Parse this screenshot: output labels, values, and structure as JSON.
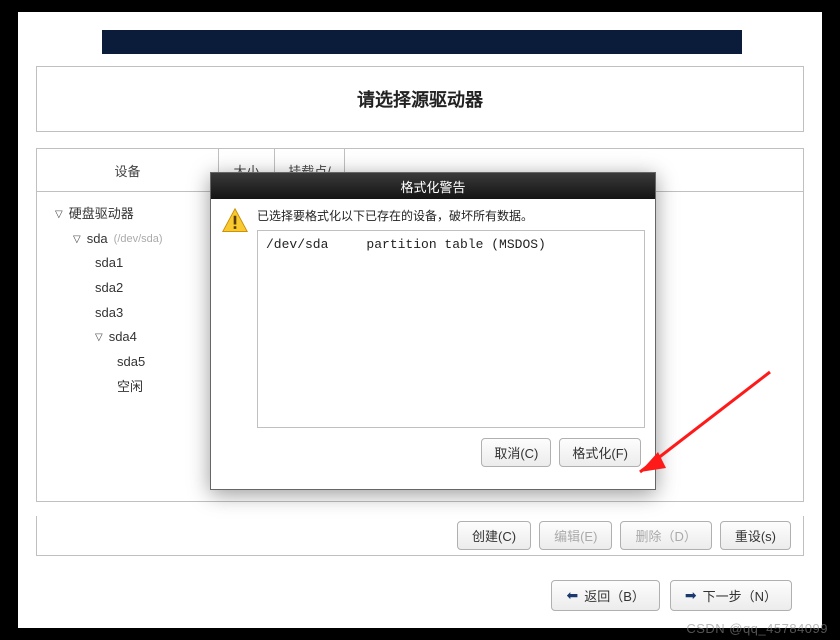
{
  "title": "请选择源驱动器",
  "columns": {
    "device": "设备",
    "size": "大小",
    "mount": "挂载点/"
  },
  "tree": {
    "root": "硬盘驱动器",
    "sda": "sda",
    "sda_path": "(/dev/sda)",
    "sda1": "sda1",
    "sda2": "sda2",
    "sda3": "sda3",
    "sda4": "sda4",
    "sda5": "sda5",
    "free": "空闲"
  },
  "buttons": {
    "create": "创建(C)",
    "edit": "编辑(E)",
    "delete": "删除（D）",
    "reset": "重设(s)",
    "back": "返回（B）",
    "next": "下一步（N）"
  },
  "dialog": {
    "title": "格式化警告",
    "message": "已选择要格式化以下已存在的设备，破坏所有数据。",
    "device": "/dev/sda",
    "desc": "partition table (MSDOS)",
    "cancel": "取消(C)",
    "format": "格式化(F)"
  },
  "watermark": "CSDN @qq_45784099"
}
